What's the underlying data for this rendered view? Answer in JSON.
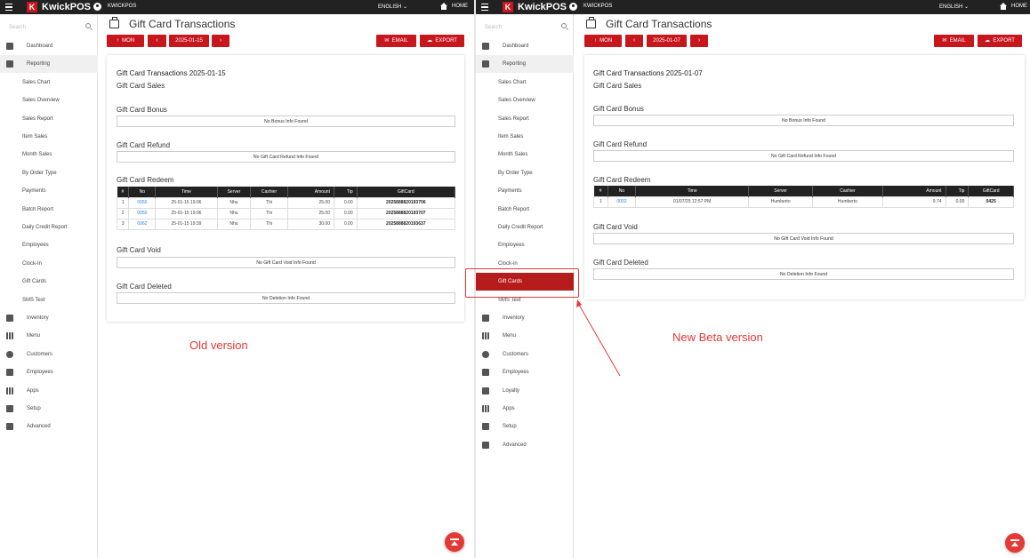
{
  "app": {
    "brand": "KwickPOS",
    "logo_letter": "K",
    "store": "KWICKPOS",
    "language": "ENGLISH",
    "home_label": "HOME"
  },
  "search": {
    "placeholder": "Search"
  },
  "colors": {
    "accent": "#c8161d",
    "topbar": "#222222",
    "link": "#1e88e5",
    "annotation": "#e53935"
  },
  "old": {
    "caption": "Old version",
    "page_title": "Gift Card Transactions",
    "toolbar": {
      "period": "MON",
      "date": "2025-01-15",
      "email": "EMAIL",
      "export": "EXPORT"
    },
    "card_title": "Gift Card Transactions 2025-01-15",
    "sections": {
      "sales": "Gift Card Sales",
      "bonus": "Gift Card Bonus",
      "bonus_empty": "No Bonus Info Found",
      "refund": "Gift Card Refund",
      "refund_empty": "No Gift Card Refund Info Found",
      "redeem": "Gift Card Redeem",
      "void": "Gift Card Void",
      "void_empty": "No Gift Card Void Info Found",
      "deleted": "Gift Card Deleted",
      "deleted_empty": "No Deletion Info Found"
    },
    "redeem_columns": [
      "#",
      "No",
      "Time",
      "Server",
      "Cashier",
      "Amount",
      "Tip",
      "GiftCard"
    ],
    "redeem_rows": [
      [
        "1",
        "0050",
        "25-01-15 19:06",
        "Nhu",
        "Thi",
        "25.00",
        "0.00",
        "2025888820193706"
      ],
      [
        "2",
        "0050",
        "25-01-15 19:06",
        "Nhu",
        "Thi",
        "25.00",
        "0.00",
        "2025888820193707"
      ],
      [
        "3",
        "0062",
        "25-01-15 19:39",
        "Nhu",
        "Thi",
        "30.00",
        "0.00",
        "2025888820193637"
      ]
    ],
    "nav": [
      {
        "label": "Dashboard",
        "icon": "dashboard-icon"
      },
      {
        "label": "Reporting",
        "icon": "reporting-icon"
      },
      {
        "label": "Sales Chart"
      },
      {
        "label": "Sales Overview"
      },
      {
        "label": "Sales Report"
      },
      {
        "label": "Item Sales"
      },
      {
        "label": "Month Sales"
      },
      {
        "label": "By Order Type"
      },
      {
        "label": "Payments"
      },
      {
        "label": "Batch Report"
      },
      {
        "label": "Daily Credit Report"
      },
      {
        "label": "Employees"
      },
      {
        "label": "Clock-In"
      },
      {
        "label": "Gift Cards"
      },
      {
        "label": "SMS Text"
      },
      {
        "label": "Inventory",
        "icon": "inventory-icon"
      },
      {
        "label": "Menu",
        "icon": "menu-grid-icon"
      },
      {
        "label": "Customers",
        "icon": "customers-icon"
      },
      {
        "label": "Employees",
        "icon": "employees-icon"
      },
      {
        "label": "Apps",
        "icon": "apps-icon"
      },
      {
        "label": "Setup",
        "icon": "gear-icon"
      },
      {
        "label": "Advanced",
        "icon": "wrench-icon"
      }
    ]
  },
  "new": {
    "caption": "New Beta version",
    "page_title": "Gift Card Transactions",
    "toolbar": {
      "period": "MON",
      "date": "2025-01-07",
      "email": "EMAIL",
      "export": "EXPORT"
    },
    "card_title": "Gift Card Transactions 2025-01-07",
    "sections": {
      "sales": "Gift Card Sales",
      "bonus": "Gift Card Bonus",
      "bonus_empty": "No Bonus Info Found",
      "refund": "Gift Card Refund",
      "refund_empty": "No Gift Card Refund Info Found",
      "redeem": "Gift Card Redeem",
      "void": "Gift Card Void",
      "void_empty": "No Gift Card Void Info Found",
      "deleted": "Gift Card Deleted",
      "deleted_empty": "No Deletion Info Found"
    },
    "redeem_columns": [
      "#",
      "No",
      "Time",
      "Server",
      "Cashier",
      "Amount",
      "Tip",
      "GiftCard"
    ],
    "redeem_rows": [
      [
        "1",
        "0032",
        "01/07/25 12:57 PM",
        "Humberto",
        "Humberto",
        "9.74",
        "0.00",
        "0425"
      ]
    ],
    "nav": [
      {
        "label": "Dashboard",
        "icon": "dashboard-icon"
      },
      {
        "label": "Reporting",
        "icon": "reporting-icon"
      },
      {
        "label": "Sales Chart"
      },
      {
        "label": "Sales Overview"
      },
      {
        "label": "Sales Report"
      },
      {
        "label": "Item Sales"
      },
      {
        "label": "Month Sales"
      },
      {
        "label": "By Order Type"
      },
      {
        "label": "Payments"
      },
      {
        "label": "Batch Report"
      },
      {
        "label": "Daily Credit Report"
      },
      {
        "label": "Employees"
      },
      {
        "label": "Clock-in"
      },
      {
        "label": "Gift Cards"
      },
      {
        "label": "SMS Text"
      },
      {
        "label": "Inventory",
        "icon": "inventory-icon"
      },
      {
        "label": "Menu",
        "icon": "menu-grid-icon"
      },
      {
        "label": "Customers",
        "icon": "customers-icon"
      },
      {
        "label": "Employees",
        "icon": "employees-icon"
      },
      {
        "label": "Loyalty",
        "icon": "loyalty-tag-icon"
      },
      {
        "label": "Apps",
        "icon": "apps-icon"
      },
      {
        "label": "Setup",
        "icon": "gear-icon"
      },
      {
        "label": "Advanced",
        "icon": "wrench-icon"
      }
    ]
  }
}
